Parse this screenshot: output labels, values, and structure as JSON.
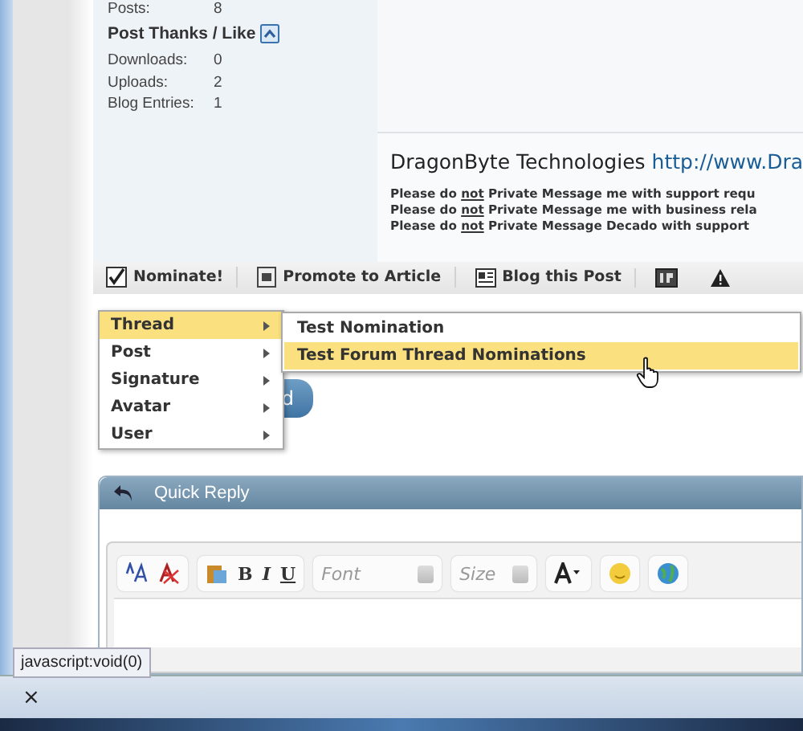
{
  "user_info": {
    "stats_top": [
      {
        "label": "Posts:",
        "value": "8"
      }
    ],
    "section_title": "Post Thanks / Like",
    "expanded": true,
    "stats": [
      {
        "label": "Downloads:",
        "value": "0"
      },
      {
        "label": "Uploads:",
        "value": "2"
      },
      {
        "label": "Blog Entries:",
        "value": "1"
      }
    ]
  },
  "signature": {
    "company": "DragonByte Technologies",
    "link": "http://www.Dra",
    "notices": [
      {
        "before": "Please do ",
        "emph": "not",
        "after": " Private Message me with support requ"
      },
      {
        "before": "Please do ",
        "emph": "not",
        "after": " Private Message me with business rela"
      },
      {
        "before": "Please do ",
        "emph": "not",
        "after": " Private Message Decado with support"
      }
    ]
  },
  "post_toolbar": [
    {
      "kind": "nominate",
      "label": "Nominate!"
    },
    {
      "kind": "promote",
      "label": "Promote to Article"
    },
    {
      "kind": "blog",
      "label": "Blog this Post"
    },
    {
      "kind": "ip"
    },
    {
      "kind": "report"
    }
  ],
  "menu": [
    {
      "label": "Thread",
      "selected": true
    },
    {
      "label": "Post",
      "selected": false
    },
    {
      "label": "Signature",
      "selected": false
    },
    {
      "label": "Avatar",
      "selected": false
    },
    {
      "label": "User",
      "selected": false
    }
  ],
  "submenu": [
    {
      "label": "Test Nomination",
      "selected": false
    },
    {
      "label": "Test Forum Thread Nominations",
      "selected": true
    }
  ],
  "partial_button": {
    "label": "d"
  },
  "quick_reply": {
    "title": "Quick Reply",
    "format_buttons": [
      "B",
      "I",
      "U"
    ],
    "font_placeholder": "Font",
    "size_placeholder": "Size"
  },
  "status_text": "javascript:void(0)",
  "bottom_bar": {
    "close": "×"
  }
}
